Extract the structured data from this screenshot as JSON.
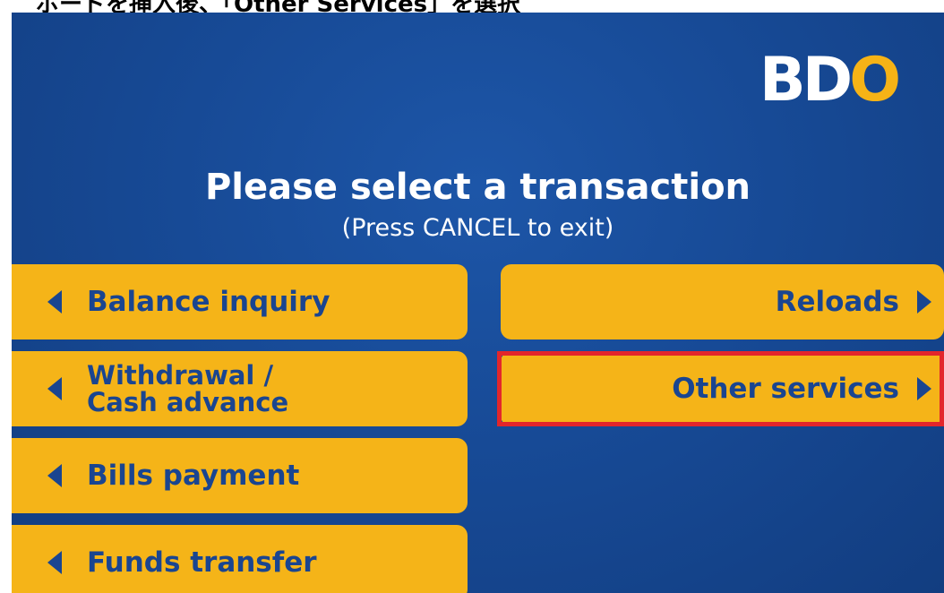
{
  "caption": {
    "text": "ボードを挿入後、「Other Services」を選択"
  },
  "logo": {
    "part1": "BD",
    "part2": "O"
  },
  "header": {
    "title": "Please select a transaction",
    "subtitle": "(Press CANCEL to exit)"
  },
  "left_buttons": [
    {
      "label": "Balance inquiry"
    },
    {
      "line1": "Withdrawal /",
      "line2": "Cash advance"
    },
    {
      "label": "Bills payment"
    },
    {
      "label": "Funds transfer"
    }
  ],
  "right_buttons": [
    {
      "label": "Reloads"
    },
    {
      "label": "Other services",
      "highlighted": true
    }
  ],
  "colors": {
    "background": "#174a96",
    "button": "#f5b418",
    "button_text": "#1a4590",
    "highlight": "#e3262b",
    "logo_accent": "#f6b316"
  },
  "icons": {
    "left_arrow": "triangle-left-icon",
    "right_arrow": "triangle-right-icon"
  }
}
